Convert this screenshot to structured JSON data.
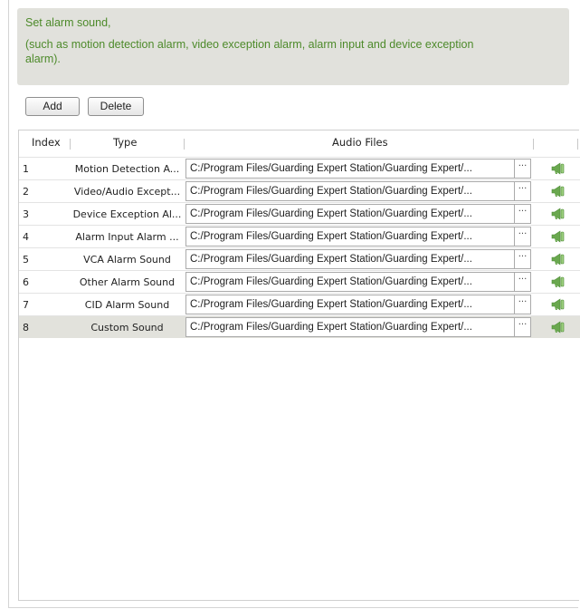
{
  "info": {
    "line1": "Set alarm sound,",
    "line2": "(such as motion detection alarm, video exception alarm, alarm input and device exception",
    "line3": "alarm)."
  },
  "toolbar": {
    "add_label": "Add",
    "delete_label": "Delete"
  },
  "table": {
    "headers": {
      "index": "Index",
      "type": "Type",
      "audio_files": "Audio Files"
    },
    "rows": [
      {
        "index": "1",
        "type": "Motion Detection A...",
        "file": "C:/Program Files/Guarding Expert Station/Guarding Expert/...",
        "browse": "···"
      },
      {
        "index": "2",
        "type": "Video/Audio Except...",
        "file": "C:/Program Files/Guarding Expert Station/Guarding Expert/...",
        "browse": "···"
      },
      {
        "index": "3",
        "type": "Device Exception Al...",
        "file": "C:/Program Files/Guarding Expert Station/Guarding Expert/...",
        "browse": "···"
      },
      {
        "index": "4",
        "type": "Alarm Input Alarm ...",
        "file": "C:/Program Files/Guarding Expert Station/Guarding Expert/...",
        "browse": "···"
      },
      {
        "index": "5",
        "type": "VCA Alarm Sound",
        "file": "C:/Program Files/Guarding Expert Station/Guarding Expert/...",
        "browse": "···"
      },
      {
        "index": "6",
        "type": "Other Alarm Sound",
        "file": "C:/Program Files/Guarding Expert Station/Guarding Expert/...",
        "browse": "···"
      },
      {
        "index": "7",
        "type": "CID Alarm Sound",
        "file": "C:/Program Files/Guarding Expert Station/Guarding Expert/...",
        "browse": "···"
      },
      {
        "index": "8",
        "type": "Custom Sound",
        "file": "C:/Program Files/Guarding Expert Station/Guarding Expert/...",
        "browse": "···"
      }
    ],
    "selected_row": "8"
  },
  "colors": {
    "info_text": "#4d8a2a",
    "info_background": "#e1e1dc",
    "selected_row": "#e2e2dc",
    "speaker_icon": "#6aa84f"
  },
  "icons": {
    "play": "speaker-icon",
    "browse": "ellipsis-icon"
  }
}
